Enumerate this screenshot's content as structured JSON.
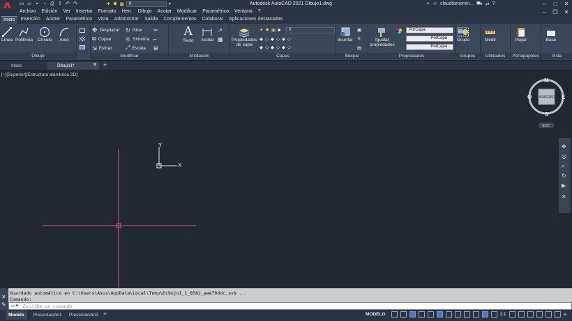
{
  "title_bar": {
    "app_title": "Autodesk AutoCAD 2021   Dibujo1.dwg",
    "layer_value": "0",
    "user_name": "claudiamoren...",
    "help": "?"
  },
  "menu_bar": [
    "Archivo",
    "Edición",
    "Ver",
    "Insertar",
    "Formato",
    "Herr.",
    "Dibujo",
    "Acotar",
    "Modificar",
    "Paramétrico",
    "Ventana",
    "?"
  ],
  "ribbon_tabs": [
    "Inicio",
    "Inserción",
    "Anotar",
    "Paramétrico",
    "Vista",
    "Administrar",
    "Salida",
    "Complementos",
    "Colaborar",
    "Aplicaciones destacadas"
  ],
  "ribbon": {
    "draw": {
      "title": "Dibujo",
      "line": "Línea",
      "polyline": "Polilínea",
      "circle": "Círculo",
      "arc": "Arco"
    },
    "modify": {
      "title": "Modificar",
      "move": "Desplazar",
      "rotate": "Girar",
      "copy": "Copiar",
      "mirror": "Simetría",
      "stretch": "Estirar",
      "scale": "Escala"
    },
    "annotation": {
      "title": "Anotación",
      "text": "Texto",
      "dimension": "Acotar"
    },
    "layers": {
      "title": "Capas",
      "layer_props": "Propiedades",
      "layer_props_2": "de capa",
      "current_layer": "0"
    },
    "block": {
      "title": "Bloque",
      "insert": "Insertar"
    },
    "properties": {
      "title": "Propiedades",
      "match": "Igualar",
      "match_2": "propiedades",
      "color": "PorCapa",
      "linetype": "PorCapa",
      "lineweight": "PorCapa"
    },
    "groups": {
      "title": "Grupos",
      "group": "Grupo"
    },
    "utilities": {
      "title": "Utilidades",
      "measure": "Medir"
    },
    "clipboard": {
      "title": "Portapapeles",
      "paste": "Pegar"
    },
    "view": {
      "title": "Vista",
      "base": "Base"
    }
  },
  "file_tabs": [
    "Inicio",
    "Dibujo1*"
  ],
  "viewport_label": "[−][Superior][Estructura alámbrica 2D]",
  "viewcube": {
    "north": "N",
    "south": "S",
    "east": "E",
    "west": "O",
    "face": "SUPERIOR",
    "ucs": "SCU"
  },
  "ucs_axes": {
    "x": "X",
    "y": "Y"
  },
  "command": {
    "history_1": "Guardado automático en C:\\Users\\Asus\\AppData\\Local\\Temp\\Dibujo1_1_8582_aae70ddc.sv$ ...",
    "history_2": "Comando:",
    "placeholder": "Escriba un comando"
  },
  "layout_tabs": [
    "Modelo",
    "Presentación1",
    "Presentación2"
  ],
  "status": {
    "mode": "MODELO",
    "scale": "1:1"
  },
  "colors": {
    "crosshair": "#d4569a",
    "canvas": "#212830",
    "ribbon": "#3b4658",
    "logo": "#d4302c"
  }
}
